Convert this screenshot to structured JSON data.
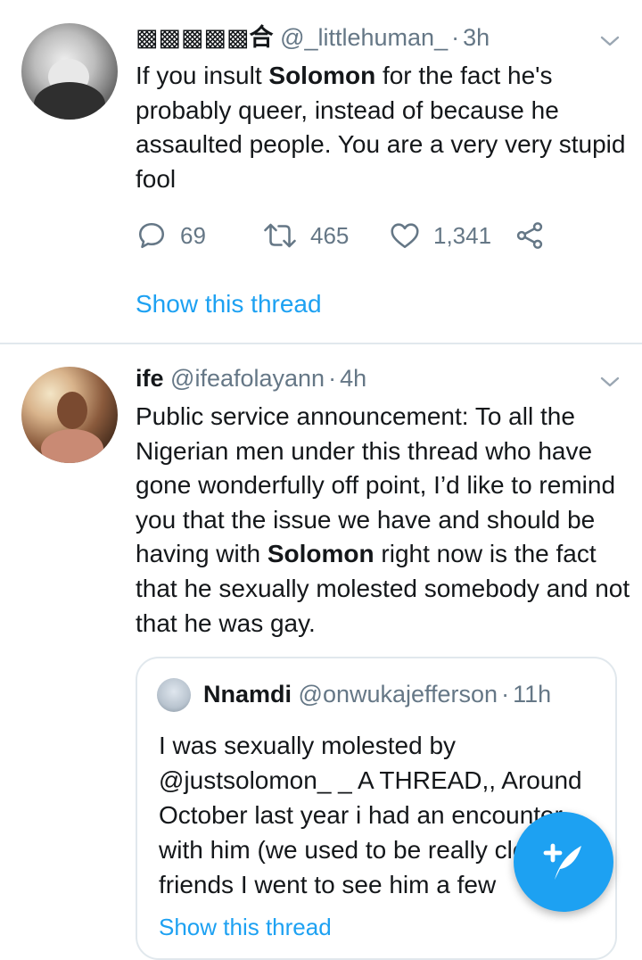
{
  "tweets": [
    {
      "display_name": "▩▩▩▩▩合",
      "handle": "@_littlehuman_",
      "time": "3h",
      "text_parts": [
        "If you insult ",
        "Solomon",
        " for the fact he's probably queer, instead of because he assaulted people. You are a very very stupid fool"
      ],
      "replies": "69",
      "retweets": "465",
      "likes": "1,341",
      "show_thread": "Show this thread"
    },
    {
      "display_name": "ife",
      "handle": "@ifeafolayann",
      "time": "4h",
      "text_parts": [
        "Public service announcement: To all the Nigerian men under this thread who have gone wonderfully off point, I’d like to remind you that the issue we have and should be having with ",
        "Solomon",
        " right now is the fact that he sexually molested somebody and not that he was gay."
      ],
      "quote": {
        "display_name": "Nnamdi",
        "handle": "@onwukajefferson",
        "time": "11h",
        "text": "I was sexually molested by @justsolomon_ _ A THREAD,, Around October last year i had an encounter with him (we used to be really close friends I went to see him a few",
        "show_thread": "Show this thread"
      }
    }
  ],
  "colors": {
    "accent": "#1da1f2",
    "secondary_text": "#657786",
    "divider": "#e1e8ed"
  },
  "icons": {
    "reply": "reply-icon",
    "retweet": "retweet-icon",
    "like": "heart-icon",
    "share": "share-icon",
    "caret": "chevron-down-icon",
    "compose": "compose-tweet-icon"
  }
}
